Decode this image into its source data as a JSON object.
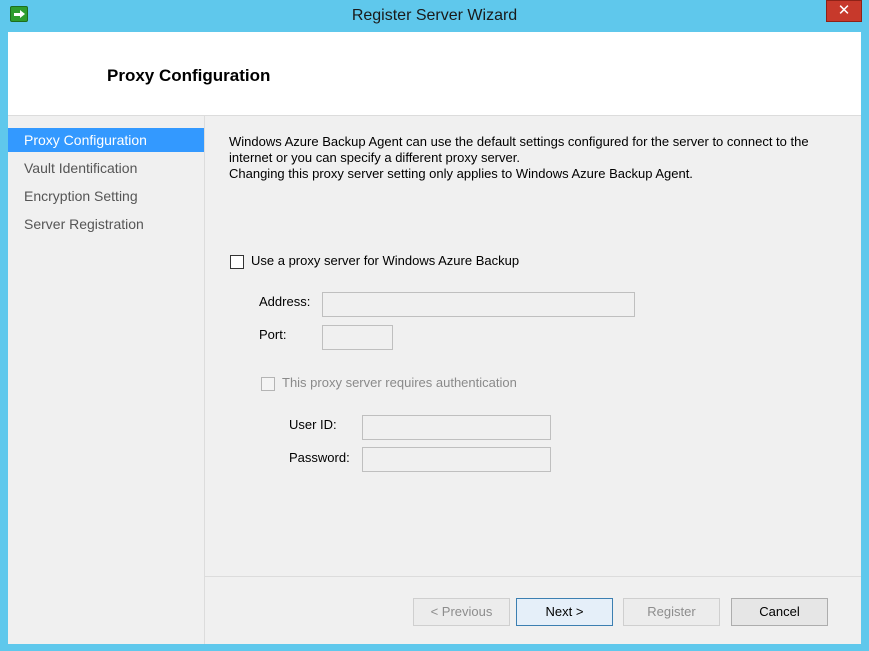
{
  "window": {
    "title": "Register Server Wizard",
    "close_glyph": "✕"
  },
  "header": {
    "title": "Proxy Configuration"
  },
  "sidebar": {
    "items": [
      {
        "label": "Proxy Configuration",
        "active": true
      },
      {
        "label": "Vault Identification",
        "active": false
      },
      {
        "label": "Encryption Setting",
        "active": false
      },
      {
        "label": "Server Registration",
        "active": false
      }
    ]
  },
  "content": {
    "description_lines": [
      "Windows Azure Backup Agent can use the default settings configured for the server to connect to the",
      "internet or you can specify a different proxy server.",
      "Changing this proxy server setting only applies to Windows Azure Backup Agent."
    ],
    "use_proxy": {
      "label": "Use a proxy server for Windows Azure Backup",
      "checked": false
    },
    "address": {
      "label": "Address:",
      "value": ""
    },
    "port": {
      "label": "Port:",
      "value": ""
    },
    "requires_auth": {
      "label": "This proxy server requires authentication",
      "checked": false
    },
    "user_id": {
      "label": "User ID:",
      "value": ""
    },
    "password": {
      "label": "Password:",
      "value": ""
    }
  },
  "buttons": {
    "previous": "< Previous",
    "next": "Next >",
    "register": "Register",
    "cancel": "Cancel"
  }
}
